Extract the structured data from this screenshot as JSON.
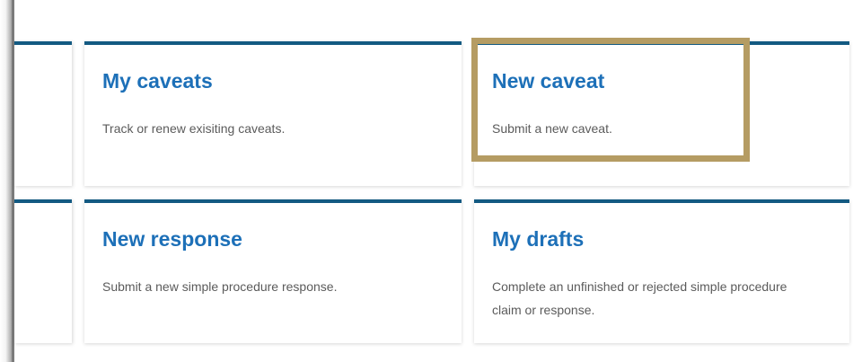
{
  "cards": [
    {
      "title": "My caveats",
      "description": "Track or renew exisiting caveats."
    },
    {
      "title": "New caveat",
      "description": "Submit a new caveat."
    },
    {
      "title": "New response",
      "description": "Submit a new simple procedure response."
    },
    {
      "title": "My drafts",
      "description": "Complete an unfinished or rejected simple procedure claim or response."
    }
  ],
  "colors": {
    "card_top_border": "#135a82",
    "title_link": "#1d70b8",
    "description_text": "#5b5b5b",
    "highlight_border": "#b59c63"
  }
}
